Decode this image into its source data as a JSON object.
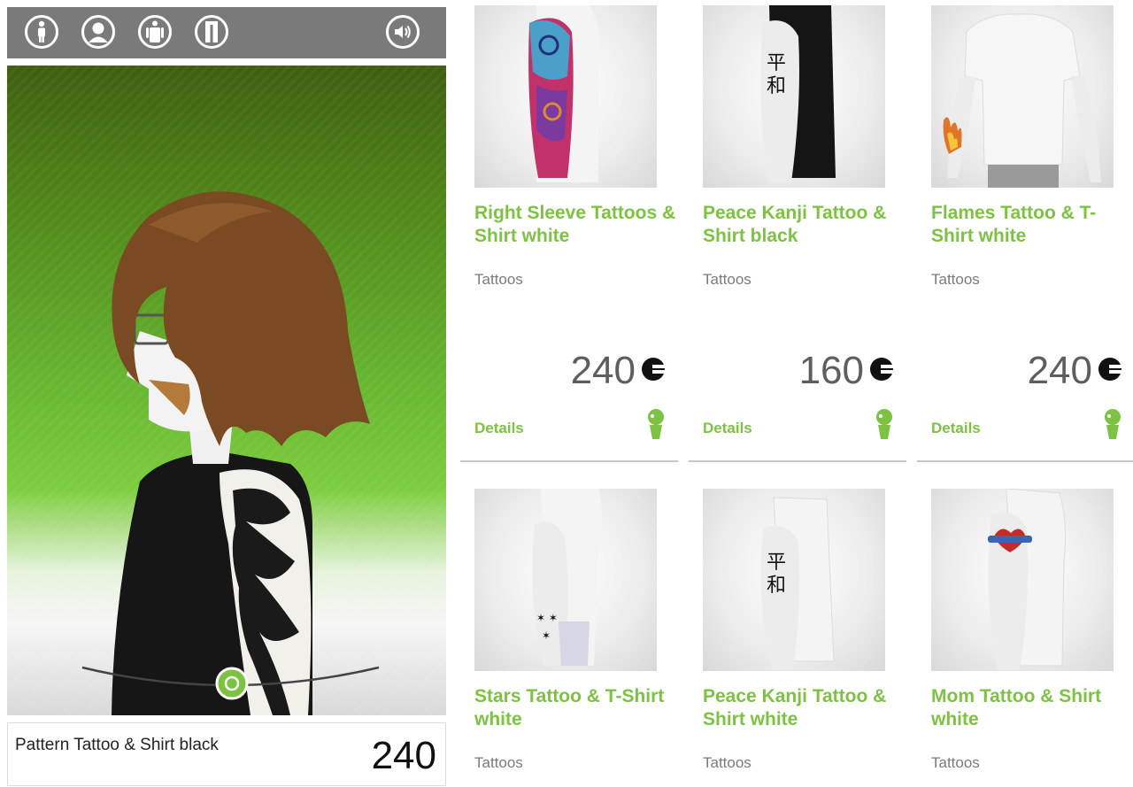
{
  "toolbar": {
    "buttons": [
      {
        "icon": "standing-avatar-icon"
      },
      {
        "icon": "head-avatar-icon"
      },
      {
        "icon": "body-avatar-icon"
      },
      {
        "icon": "legs-avatar-icon"
      },
      {
        "icon": "speaker-icon"
      }
    ]
  },
  "preview": {
    "selected_name": "Pattern Tattoo & Shirt black",
    "selected_price": "240"
  },
  "colors": {
    "accent_green": "#7dc242",
    "toolbar_gray": "#7a7a7a"
  },
  "products": [
    {
      "title": "Right Sleeve Tattoos & Shirt white",
      "category": "Tattoos",
      "price": "240",
      "details_label": "Details"
    },
    {
      "title": "Peace Kanji Tattoo & Shirt black",
      "category": "Tattoos",
      "price": "160",
      "details_label": "Details"
    },
    {
      "title": "Flames Tattoo & T-Shirt white",
      "category": "Tattoos",
      "price": "240",
      "details_label": "Details"
    },
    {
      "title": "Stars Tattoo & T-Shirt white",
      "category": "Tattoos"
    },
    {
      "title": "Peace Kanji Tattoo & Shirt white",
      "category": "Tattoos"
    },
    {
      "title": "Mom Tattoo & Shirt white",
      "category": "Tattoos"
    }
  ]
}
